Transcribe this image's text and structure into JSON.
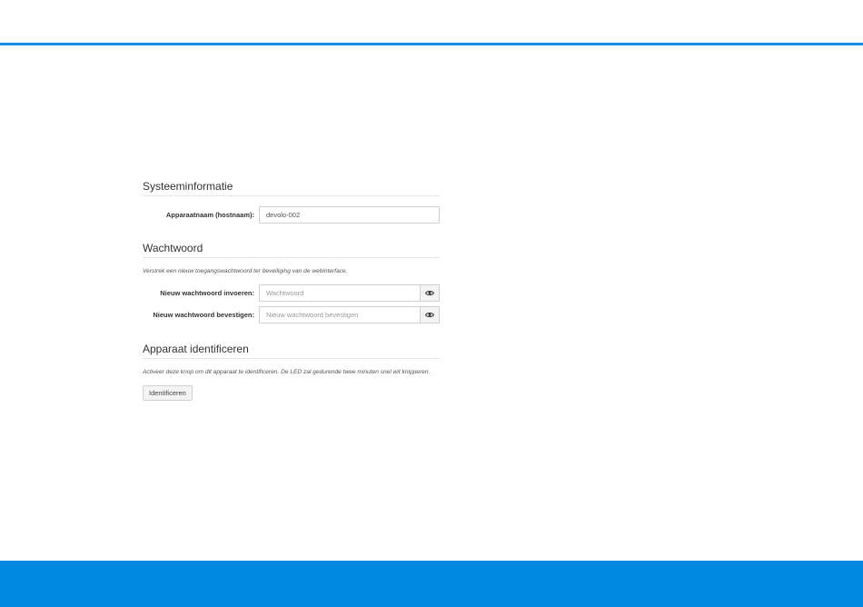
{
  "colors": {
    "accent": "#1a90e6",
    "footer": "#0088e3",
    "divider": "#e6e6e6",
    "input_border": "#d0d0d0",
    "button_bg": "#f4f4f4"
  },
  "system_info": {
    "title": "Systeeminformatie",
    "hostname_label": "Apparaatnaam (hostnaam):",
    "hostname_value": "devolo-002"
  },
  "password": {
    "title": "Wachtwoord",
    "description": "Verstrek een nieuw toegangswachtwoord ter beveiliging van de webinterface.",
    "new_label": "Nieuw wachtwoord invoeren:",
    "new_placeholder": "Wachtwoord",
    "new_value": "",
    "confirm_label": "Nieuw wachtwoord bevestigen:",
    "confirm_placeholder": "Nieuw wachtwoord bevestigen",
    "confirm_value": "",
    "toggle_icon": "eye-icon"
  },
  "identify": {
    "title": "Apparaat identificeren",
    "description": "Activeer deze knop om dit apparaat te identificeren. De LED zal gedurende twee minuten snel wit knipperen.",
    "button_label": "Identificeren"
  }
}
